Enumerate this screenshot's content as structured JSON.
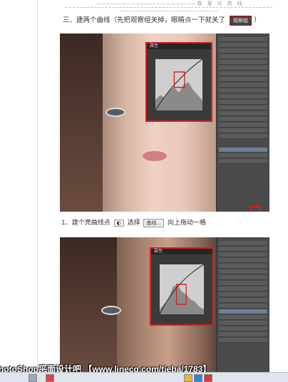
{
  "separator": {
    "text": "———————————————————— 我　是　分　割　线 ————————————————————"
  },
  "step3": {
    "heading": "三、建两个曲线（先把观察组关掉，眼睛点一下就关了",
    "badge": "观察组",
    "close_paren": "）"
  },
  "step1": {
    "prefix": "1、建个亮曲线点",
    "select_text": "选择",
    "curve_label": "曲线...",
    "suffix": "向上拖动一格"
  },
  "ps": {
    "curves_title": "属性",
    "curves_preset": "曲线"
  },
  "watermark": "hotoShop平面设计吧 【www.linecg.com/tieba/1783】",
  "colors": {
    "highlight": "#d51f1f",
    "panel": "#4a4a4a"
  }
}
